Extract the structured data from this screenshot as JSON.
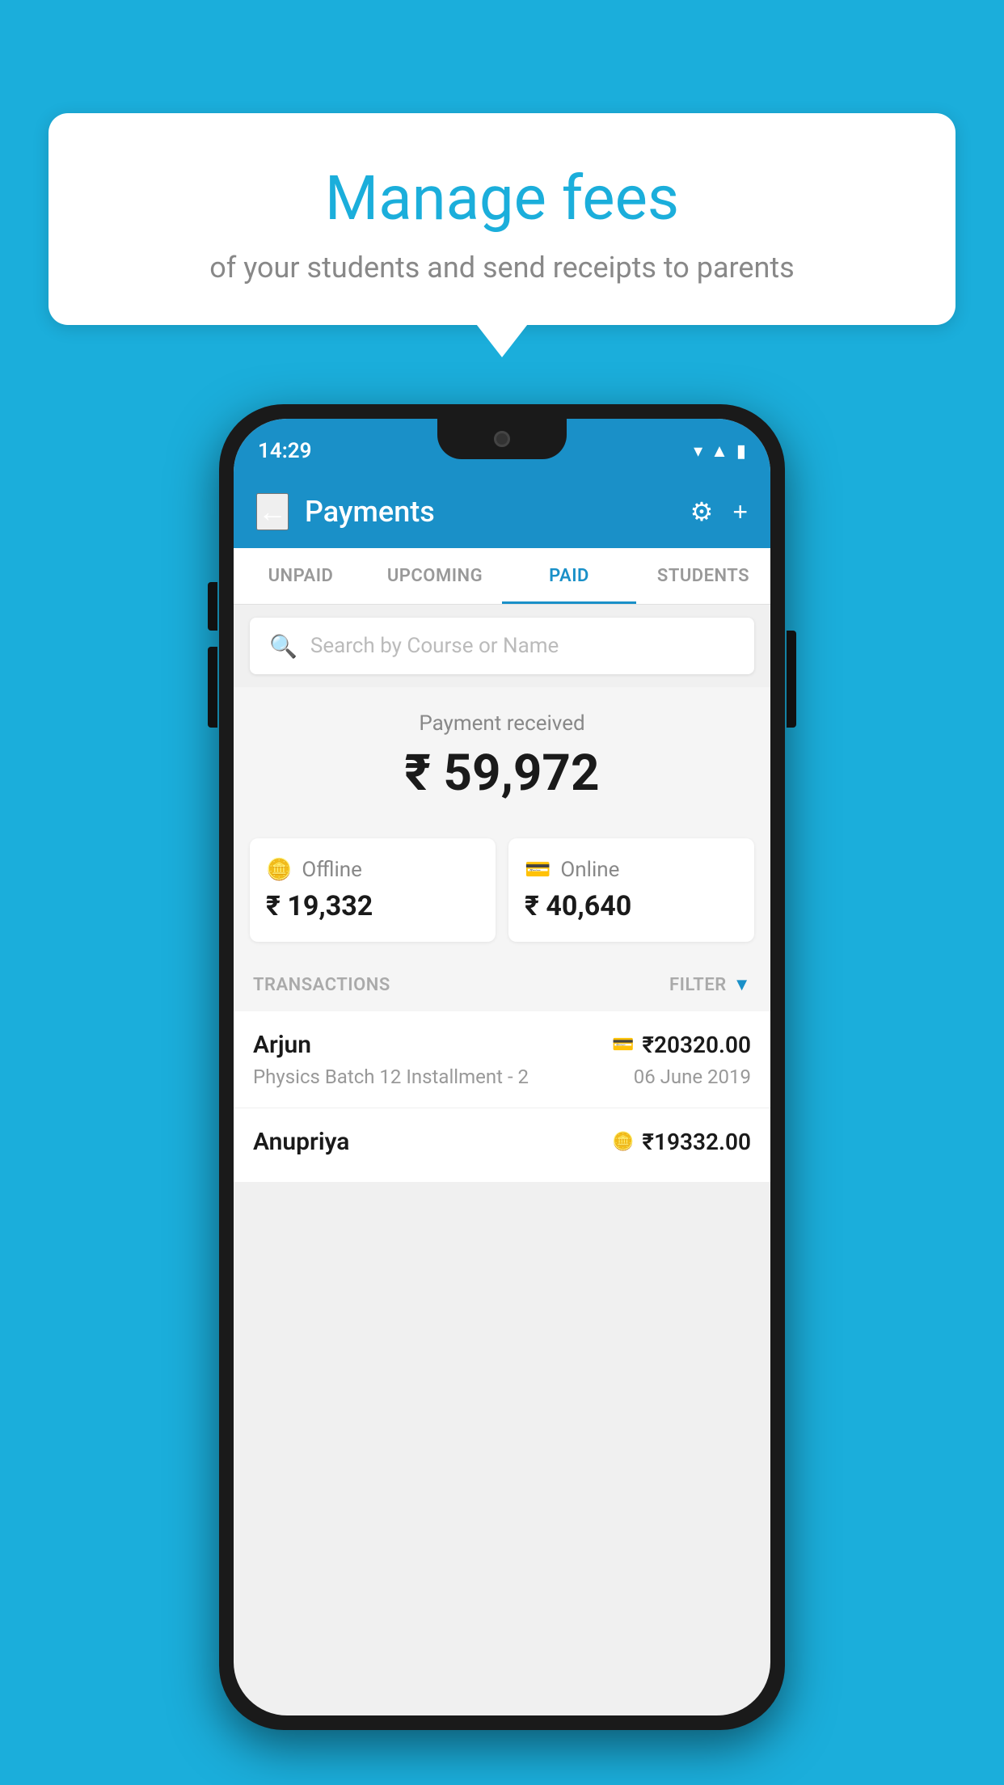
{
  "background_color": "#1BAEDB",
  "tooltip": {
    "title": "Manage fees",
    "subtitle": "of your students and send receipts to parents"
  },
  "phone": {
    "status_bar": {
      "time": "14:29"
    },
    "header": {
      "title": "Payments",
      "back_label": "←",
      "gear_label": "⚙",
      "plus_label": "+"
    },
    "tabs": [
      {
        "label": "UNPAID",
        "active": false
      },
      {
        "label": "UPCOMING",
        "active": false
      },
      {
        "label": "PAID",
        "active": true
      },
      {
        "label": "STUDENTS",
        "active": false
      }
    ],
    "search": {
      "placeholder": "Search by Course or Name"
    },
    "payment_summary": {
      "label": "Payment received",
      "amount": "₹ 59,972"
    },
    "payment_cards": [
      {
        "type": "Offline",
        "amount": "₹ 19,332",
        "icon": "💳"
      },
      {
        "type": "Online",
        "amount": "₹ 40,640",
        "icon": "💳"
      }
    ],
    "transactions_label": "TRANSACTIONS",
    "filter_label": "FILTER",
    "transactions": [
      {
        "name": "Arjun",
        "amount": "₹20320.00",
        "course": "Physics Batch 12 Installment - 2",
        "date": "06 June 2019",
        "payment_type": "online"
      },
      {
        "name": "Anupriya",
        "amount": "₹19332.00",
        "course": "",
        "date": "",
        "payment_type": "offline"
      }
    ]
  }
}
